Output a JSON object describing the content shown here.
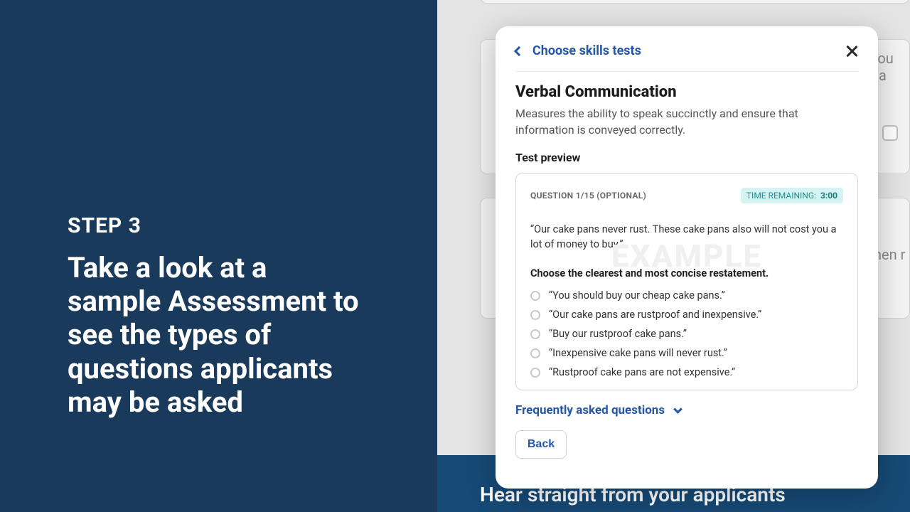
{
  "left": {
    "step_label": "STEP 3",
    "description": "Take a look at a sample Assessment to see the types of questions applicants may be asked"
  },
  "background": {
    "right_text_1": "you ha",
    "right_text_2": "hen r"
  },
  "blue_band": {
    "headline": "Hear straight from your applicants"
  },
  "modal": {
    "back_nav_label": "Choose skills tests",
    "title": "Verbal Communication",
    "description": "Measures the ability to speak succinctly and ensure that information is conveyed correctly.",
    "preview_label": "Test preview",
    "watermark": "EXAMPLE",
    "question_meta": "QUESTION 1/15 (OPTIONAL)",
    "time_label": "TIME REMAINING:",
    "time_value": "3:00",
    "prompt_quote": "“Our cake pans never rust.  These cake pans also will not cost you a lot of money to buy.”",
    "prompt_instruction": "Choose the clearest and most concise restatement.",
    "options": [
      "“You should buy our cheap cake pans.”",
      "“Our cake pans are rustproof and inexpensive.”",
      "“Buy our rustproof cake pans.”",
      "“Inexpensive cake pans will never rust.”",
      "“Rustproof cake pans are not expensive.”"
    ],
    "faq_label": "Frequently asked questions",
    "back_button": "Back"
  }
}
